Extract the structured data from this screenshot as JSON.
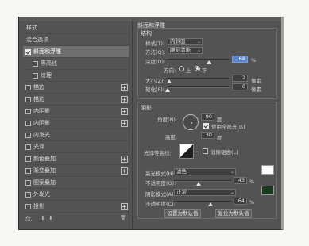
{
  "left_panel": {
    "items": [
      {
        "label": "样式",
        "checkbox": false,
        "checked": false,
        "plus": false,
        "indent": 0
      },
      {
        "label": "混合选项",
        "checkbox": false,
        "checked": false,
        "plus": false,
        "indent": 0
      },
      {
        "label": "斜面和浮雕",
        "checkbox": true,
        "checked": true,
        "plus": false,
        "indent": 0
      },
      {
        "label": "等高线",
        "checkbox": true,
        "checked": false,
        "plus": false,
        "indent": 1
      },
      {
        "label": "纹理",
        "checkbox": true,
        "checked": false,
        "plus": false,
        "indent": 1
      },
      {
        "label": "描边",
        "checkbox": true,
        "checked": false,
        "plus": true,
        "indent": 0
      },
      {
        "label": "描边",
        "checkbox": true,
        "checked": false,
        "plus": true,
        "indent": 0
      },
      {
        "label": "内阴影",
        "checkbox": true,
        "checked": false,
        "plus": true,
        "indent": 0
      },
      {
        "label": "内阴影",
        "checkbox": true,
        "checked": false,
        "plus": true,
        "indent": 0
      },
      {
        "label": "内发光",
        "checkbox": true,
        "checked": false,
        "plus": false,
        "indent": 0
      },
      {
        "label": "光泽",
        "checkbox": true,
        "checked": false,
        "plus": false,
        "indent": 0
      },
      {
        "label": "颜色叠加",
        "checkbox": true,
        "checked": false,
        "plus": true,
        "indent": 0
      },
      {
        "label": "渐变叠加",
        "checkbox": true,
        "checked": false,
        "plus": true,
        "indent": 0
      },
      {
        "label": "图案叠加",
        "checkbox": true,
        "checked": false,
        "plus": false,
        "indent": 0
      },
      {
        "label": "外发光",
        "checkbox": true,
        "checked": false,
        "plus": false,
        "indent": 0
      },
      {
        "label": "投影",
        "checkbox": true,
        "checked": false,
        "plus": true,
        "indent": 0
      }
    ],
    "bottom": {
      "fx": "fx.",
      "up": "⬆",
      "down": "⬇",
      "trash": "🗑"
    }
  },
  "bevel": {
    "title": "斜面和浮雕",
    "structure_title": "结构",
    "style_label": "样式(T):",
    "style_value": "内斜面",
    "technique_label": "方法(Q):",
    "technique_value": "雕刻清晰",
    "depth_label": "深度(D):",
    "depth_value": "68",
    "depth_unit": "%",
    "direction_label": "方向:",
    "dir_up": "上",
    "dir_down": "下",
    "direction_selected": "下",
    "size_label": "大小(Z):",
    "size_value": "2",
    "size_unit": "像素",
    "soften_label": "软化(F):",
    "soften_value": "0",
    "soften_unit": "像素"
  },
  "shading": {
    "title": "阴影",
    "angle_label": "角度(N):",
    "angle_value": "90",
    "angle_unit": "度",
    "global_light_label": "使用全局光(G)",
    "global_light_checked": true,
    "altitude_label": "高度:",
    "altitude_value": "30",
    "altitude_unit": "度",
    "gloss_label": "光泽等高线:",
    "antialias_label": "消除锯齿(L)",
    "antialias_checked": false,
    "highlight_mode_label": "高光模式(H):",
    "highlight_mode_value": "滤色",
    "highlight_color": "#ffffff",
    "opacity1_label": "不透明度(O):",
    "opacity1_value": "43",
    "opacity_unit": "%",
    "shadow_mode_label": "阴影模式(A):",
    "shadow_mode_value": "正常",
    "shadow_color": "#1a3a22",
    "opacity2_label": "不透明度(C):",
    "opacity2_value": "64"
  },
  "levels": {
    "depth": 0.68,
    "size": 0.02,
    "soften": 0.0,
    "opacity1": 0.43,
    "opacity2": 0.64
  },
  "buttons": {
    "make_default": "设置为默认值",
    "reset_default": "复位为默认值"
  }
}
